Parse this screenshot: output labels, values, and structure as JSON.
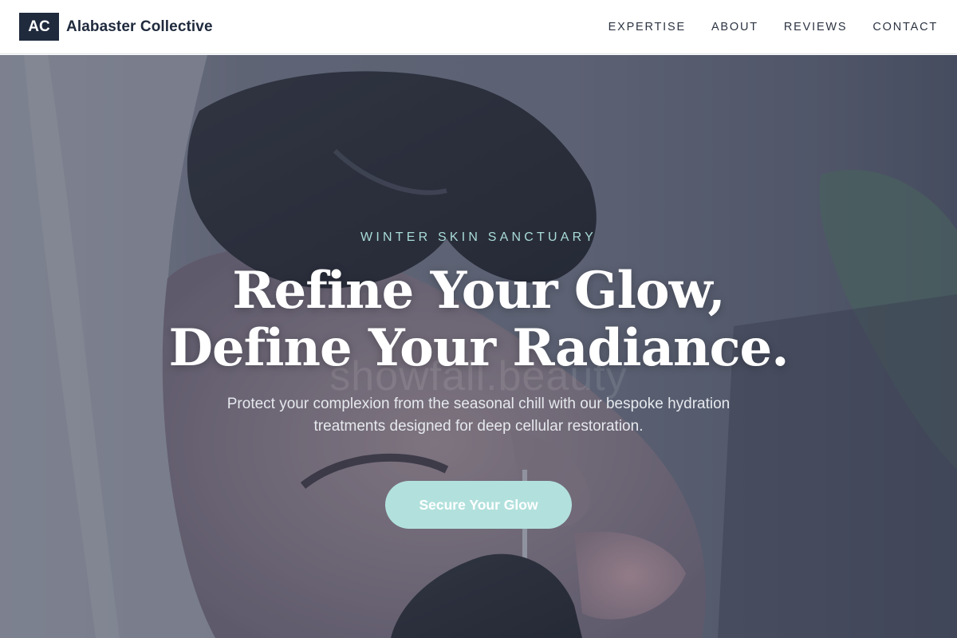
{
  "brand": {
    "mark": "AC",
    "name": "Alabaster Collective"
  },
  "nav": {
    "items": [
      {
        "label": "EXPERTISE"
      },
      {
        "label": "ABOUT"
      },
      {
        "label": "REVIEWS"
      },
      {
        "label": "CONTACT"
      }
    ]
  },
  "hero": {
    "eyebrow": "WINTER SKIN SANCTUARY",
    "headline_line1": "Refine Your Glow,",
    "headline_line2": "Define Your Radiance.",
    "subtitle": "Protect your complexion from the seasonal chill with our bespoke hydration treatments designed for deep cellular restoration.",
    "watermark": "showfall.beauty",
    "cta_label": "Secure Your Glow"
  },
  "colors": {
    "brand_navy": "#1f2a3d",
    "accent_mint": "#b2e1dd",
    "eyebrow_mint": "#a9dcd8"
  }
}
